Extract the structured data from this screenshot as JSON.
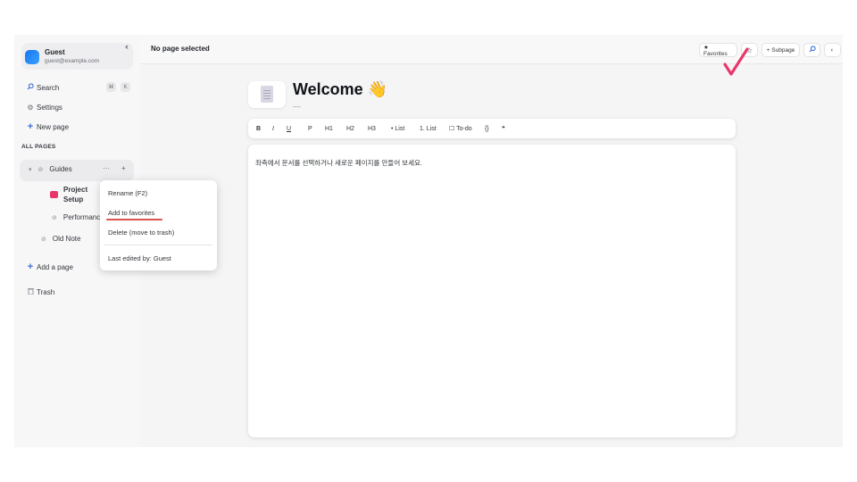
{
  "user": {
    "name": "Guest",
    "email": "guest@example.com"
  },
  "sidebar": {
    "collapse": "‹‹",
    "search": {
      "label": "Search",
      "shortcut": "⌘",
      "shortcut2": "K"
    },
    "settings": "Settings",
    "new_page": "New page",
    "section_label": "ALL PAGES",
    "tree": [
      {
        "label": "Guides",
        "more": "···",
        "add": "+"
      },
      {
        "label": "Project Setup"
      },
      {
        "label": "Performance"
      },
      {
        "label": "Old Note"
      }
    ],
    "add_page": "Add a page",
    "trash": "Trash"
  },
  "context_menu": {
    "items": [
      "Rename (F2)",
      "Add to favorites",
      "Delete (move to trash)"
    ],
    "footer": "Last edited by: Guest"
  },
  "topbar": {
    "status": "No page selected",
    "favorites": "★ Favorites",
    "star": "☆",
    "subpage": "+ Subpage"
  },
  "page": {
    "title": "Welcome 👋",
    "subtitle_dash": "—",
    "body": "좌측에서 문서를 선택하거나 새로운 페이지를 만들어 보세요."
  },
  "toolbar": {
    "bold": "B",
    "italic": "I",
    "underline": "U",
    "paragraph": "P",
    "h1": "H1",
    "h2": "H2",
    "h3": "H3",
    "bullet": "• List",
    "numbered": "1. List",
    "todo": "☐ To-do",
    "code": "{}",
    "quote": "❝"
  },
  "colors": {
    "accent_pink": "#e8376a",
    "underline_red": "#d9534f",
    "avatar_blue": "#1877f2"
  }
}
